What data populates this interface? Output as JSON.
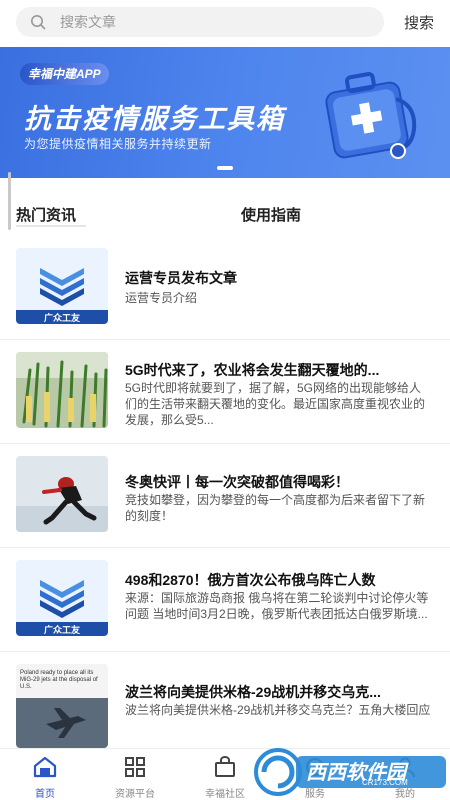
{
  "search": {
    "placeholder": "搜索文章",
    "button_label": "搜索"
  },
  "banner": {
    "tag": "幸福中建APP",
    "title": "抗击疫情服务工具箱",
    "subtitle": "为您提供疫情相关服务并持续更新"
  },
  "tabs": [
    {
      "label": "热门资讯"
    },
    {
      "label": "使用指南"
    }
  ],
  "news": [
    {
      "title": "运营专员发布文章",
      "desc": "运营专员介绍",
      "thumb_label": "广众工友"
    },
    {
      "title": "5G时代来了，农业将会发生翻天覆地的...",
      "desc": "5G时代即将就要到了，据了解，5G网络的出现能够给人们的生活带来翻天覆地的变化。最近国家高度重视农业的发展，那么受5..."
    },
    {
      "title": "冬奥快评丨每一次突破都值得喝彩！",
      "desc": "竞技如攀登，因为攀登的每一个高度都为后来者留下了新的刻度！"
    },
    {
      "title": "498和2870！俄方首次公布俄乌阵亡人数",
      "desc": "来源：国际旅游岛商报 俄乌将在第二轮谈判中讨论停火等问题 当地时间3月2日晚，俄罗斯代表团抵达白俄罗斯境...",
      "thumb_label": "广众工友"
    },
    {
      "title": "波兰将向美提供米格-29战机并移交乌克...",
      "desc": "波兰将向美提供米格-29战机并移交乌克兰？五角大楼回应",
      "thumb_text": "Poland ready to place all its MiG-29 jets at the disposal of U.S."
    }
  ],
  "bottom_nav": [
    {
      "label": "首页",
      "icon": "home-icon",
      "active": true
    },
    {
      "label": "资源平台",
      "icon": "grid-icon"
    },
    {
      "label": "幸福社区",
      "icon": "bag-icon"
    },
    {
      "label": "服务",
      "icon": "service-icon"
    },
    {
      "label": "我的",
      "icon": "user-icon"
    }
  ],
  "watermark": {
    "text": "西西软件园",
    "sub": "CR173.COM"
  },
  "colors": {
    "accent": "#2a56c7",
    "banner": "#4f86ee"
  }
}
